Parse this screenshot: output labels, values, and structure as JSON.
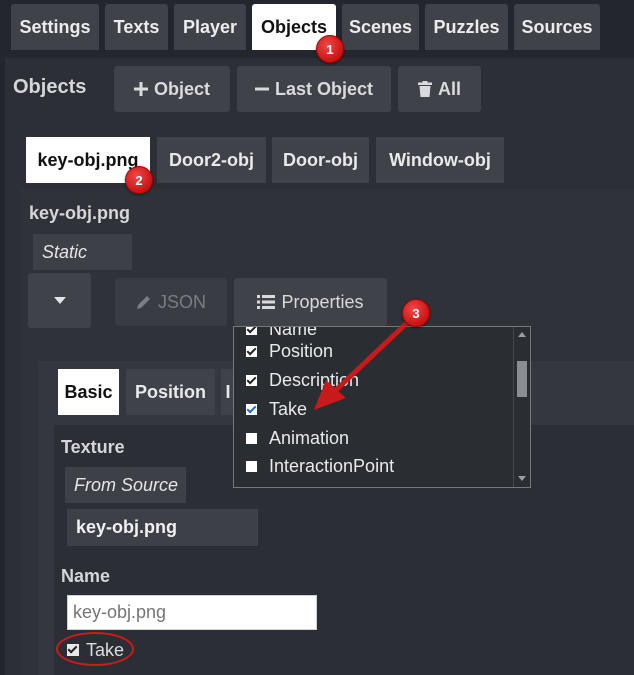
{
  "top_tabs": [
    "Settings",
    "Texts",
    "Player",
    "Objects",
    "Scenes",
    "Puzzles",
    "Sources"
  ],
  "objects_section": {
    "heading": "Objects",
    "add_object_label": "Object",
    "last_object_label": "Last Object",
    "all_label": "All"
  },
  "object_tabs": [
    "key-obj.png",
    "Door2-obj",
    "Door-obj",
    "Window-obj"
  ],
  "object_panel": {
    "title": "key-obj.png",
    "type_value": "Static",
    "json_label": "JSON",
    "properties_label": "Properties"
  },
  "property_dropdown": {
    "items": [
      {
        "label": "Name",
        "checked": true
      },
      {
        "label": "Position",
        "checked": true
      },
      {
        "label": "Description",
        "checked": true
      },
      {
        "label": "Take",
        "checked": true
      },
      {
        "label": "Animation",
        "checked": false
      },
      {
        "label": "InteractionPoint",
        "checked": false
      }
    ]
  },
  "sub_tabs": [
    "Basic",
    "Position",
    "I"
  ],
  "basic_panel": {
    "texture_label": "Texture",
    "texture_source": "From Source",
    "texture_value": "key-obj.png",
    "name_label": "Name",
    "name_placeholder": "key-obj.png",
    "take_label": "Take"
  },
  "annotations": {
    "badge1": "1",
    "badge2": "2",
    "badge3": "3"
  },
  "colors": {
    "background": "#23262c",
    "tab": "#3f4248",
    "active_tab": "#ffffff",
    "annotation_red": "#d11a1a"
  }
}
